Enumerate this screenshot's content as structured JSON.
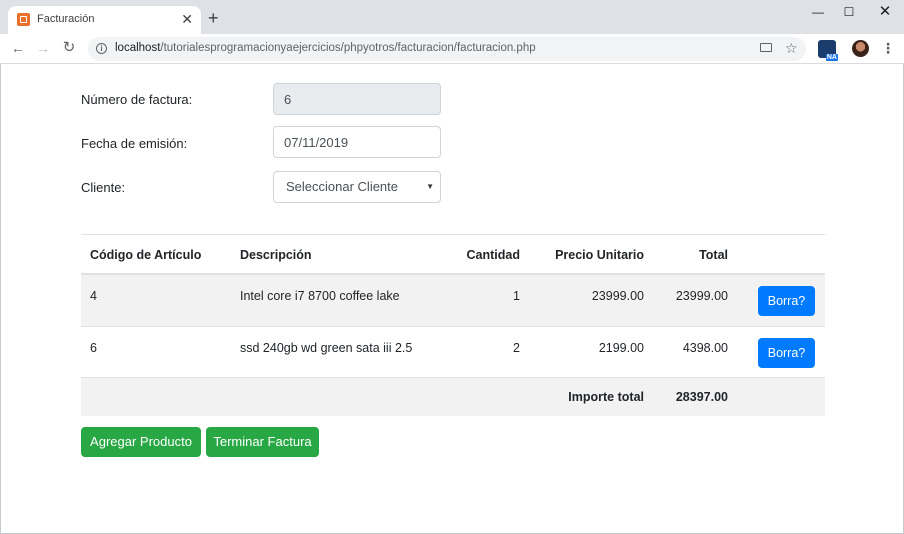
{
  "browser": {
    "tab_title": "Facturación",
    "tab_close": "✕",
    "new_tab": "+",
    "url_host": "localhost",
    "url_path": "/tutorialesprogramacionyaejercicios/phpyotros/facturacion/facturacion.php",
    "icons": [
      "back-arrow-icon",
      "forward-arrow-icon",
      "reload-icon",
      "info-icon",
      "cast-icon",
      "star-icon",
      "extension-icon",
      "avatar",
      "menu-dots-icon"
    ]
  },
  "form": {
    "numero_label": "Número de factura:",
    "numero_value": "6",
    "fecha_label": "Fecha de emisión:",
    "fecha_value": "07/11/2019",
    "cliente_label": "Cliente:",
    "cliente_selected": "Seleccionar Cliente"
  },
  "table": {
    "headers": {
      "codigo": "Código de Artículo",
      "descripcion": "Descripción",
      "cantidad": "Cantidad",
      "precio": "Precio Unitario",
      "total": "Total"
    },
    "rows": [
      {
        "codigo": "4",
        "descripcion": "Intel core i7 8700 coffee lake",
        "cantidad": "1",
        "precio": "23999.00",
        "total": "23999.00",
        "delete_label": "Borra?"
      },
      {
        "codigo": "6",
        "descripcion": "ssd 240gb wd green sata iii 2.5",
        "cantidad": "2",
        "precio": "2199.00",
        "total": "4398.00",
        "delete_label": "Borra?"
      }
    ],
    "footer": {
      "label": "Importe total",
      "value": "28397.00"
    }
  },
  "actions": {
    "add_label": "Agregar Producto",
    "finish_label": "Terminar Factura"
  },
  "colors": {
    "primary": "#007bff",
    "success": "#28a745",
    "stripe": "#f2f2f2",
    "readonly_bg": "#e9ecef"
  }
}
